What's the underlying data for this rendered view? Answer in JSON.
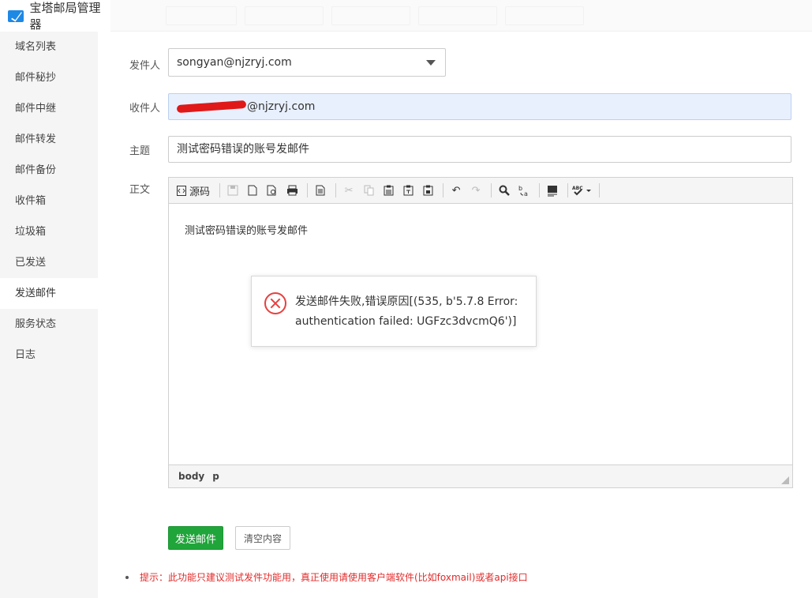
{
  "app": {
    "title": "宝塔邮局管理器"
  },
  "sidebar": {
    "items": [
      {
        "label": "域名列表"
      },
      {
        "label": "邮件秘抄"
      },
      {
        "label": "邮件中继"
      },
      {
        "label": "邮件转发"
      },
      {
        "label": "邮件备份"
      },
      {
        "label": "收件箱"
      },
      {
        "label": "垃圾箱"
      },
      {
        "label": "已发送"
      },
      {
        "label": "发送邮件",
        "active": true
      },
      {
        "label": "服务状态"
      },
      {
        "label": "日志"
      }
    ]
  },
  "form": {
    "sender_label": "发件人",
    "sender_value": "songyan@njzryj.com",
    "recipient_label": "收件人",
    "recipient_value_visible": "@njzryj.com",
    "subject_label": "主题",
    "subject_value": "测试密码错误的账号发邮件",
    "body_label": "正文"
  },
  "editor": {
    "source_label": "源码",
    "content": "测试密码错误的账号发邮件",
    "path": [
      "body",
      "p"
    ]
  },
  "buttons": {
    "send": "发送邮件",
    "clear": "清空内容"
  },
  "hint": "提示：此功能只建议测试发件功能用，真正使用请使用客户端软件(比如foxmail)或者api接口",
  "popup": {
    "message": "发送邮件失败,错误原因[(535, b'5.7.8 Error: authentication failed: UGFzc3dvcmQ6')]"
  },
  "colors": {
    "primary_green": "#20a53a",
    "error_red": "#e64141",
    "hint_red": "#e32b2b",
    "recipient_bg": "#e8f0fe"
  }
}
